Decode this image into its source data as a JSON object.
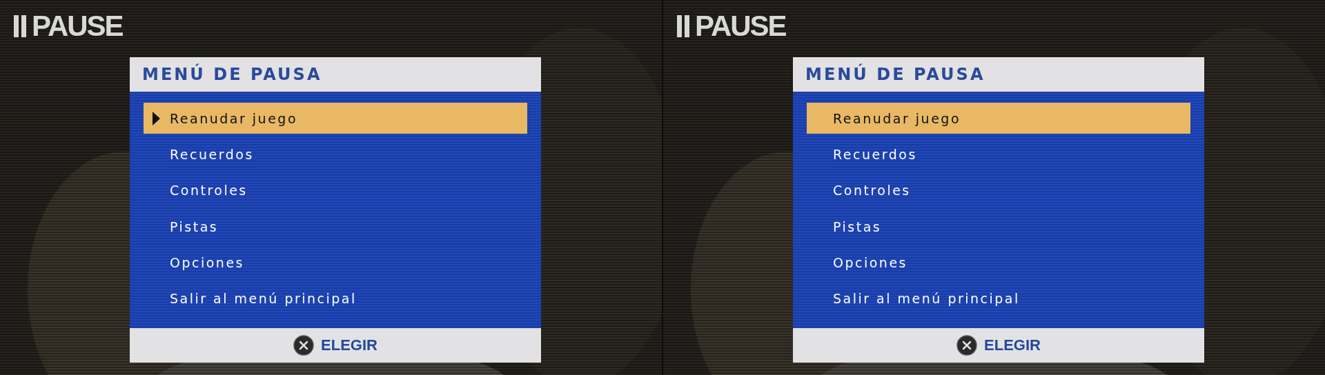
{
  "screens": [
    {
      "pause_label": "PAUSE",
      "menu": {
        "title": "MENÚ DE PAUSA",
        "cursor_shown": true,
        "items": [
          {
            "label": "Reanudar juego",
            "selected": true
          },
          {
            "label": "Recuerdos",
            "selected": false
          },
          {
            "label": "Controles",
            "selected": false
          },
          {
            "label": "Pistas",
            "selected": false
          },
          {
            "label": "Opciones",
            "selected": false
          },
          {
            "label": "Salir al menú principal",
            "selected": false
          }
        ],
        "footer": {
          "action": "ELEGIR"
        }
      }
    },
    {
      "pause_label": "PAUSE",
      "menu": {
        "title": "MENÚ DE PAUSA",
        "cursor_shown": false,
        "items": [
          {
            "label": "Reanudar juego",
            "selected": true
          },
          {
            "label": "Recuerdos",
            "selected": false
          },
          {
            "label": "Controles",
            "selected": false
          },
          {
            "label": "Pistas",
            "selected": false
          },
          {
            "label": "Opciones",
            "selected": false
          },
          {
            "label": "Salir al menú principal",
            "selected": false
          }
        ],
        "footer": {
          "action": "ELEGIR"
        }
      }
    }
  ]
}
